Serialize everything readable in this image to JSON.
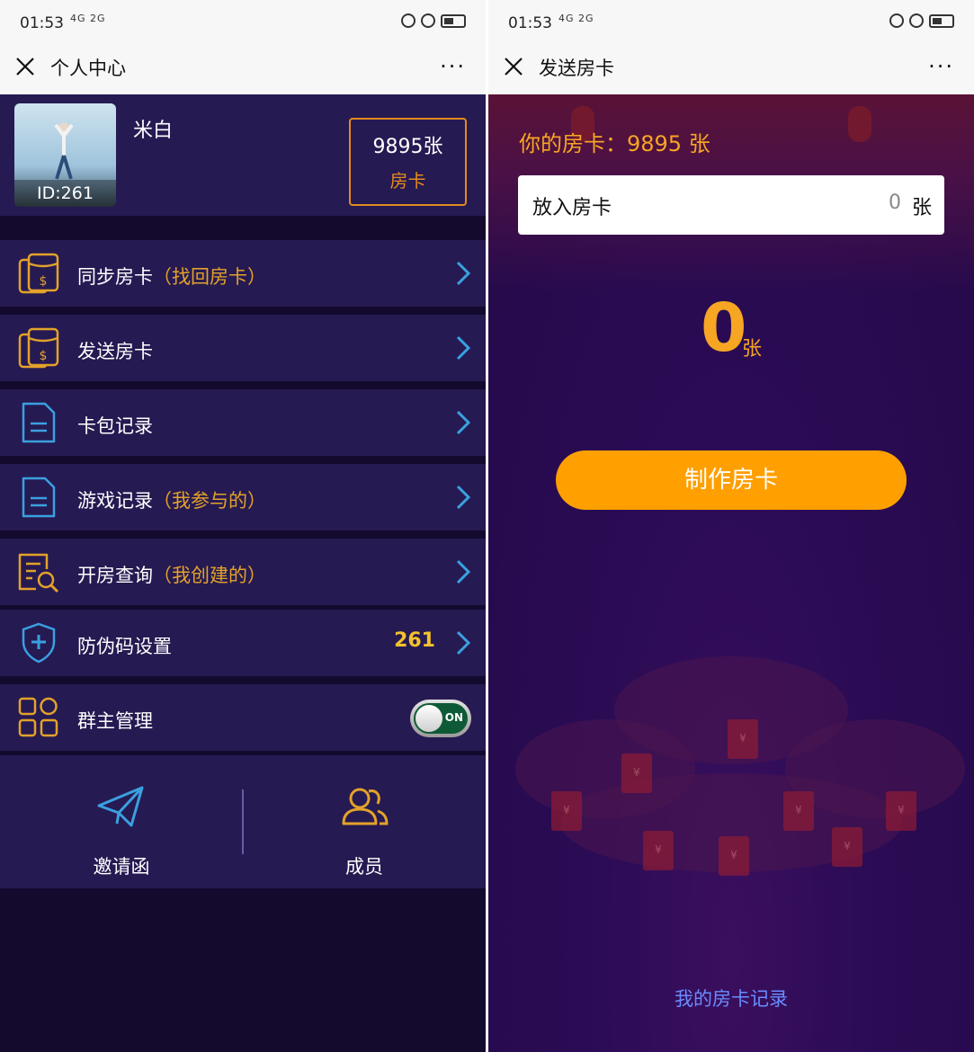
{
  "status_bar": {
    "time": "01:53",
    "signal": "4G 2G"
  },
  "left": {
    "title": "个人中心",
    "profile": {
      "name": "米白",
      "id": "ID:261",
      "card_count": "9895张",
      "card_label": "房卡"
    },
    "menu": [
      {
        "label": "同步房卡",
        "hint": "（找回房卡）",
        "icon": "coin-card-icon"
      },
      {
        "label": "发送房卡",
        "hint": "",
        "icon": "coin-card-icon"
      },
      {
        "label": "卡包记录",
        "hint": "",
        "icon": "document-icon"
      },
      {
        "label": "游戏记录",
        "hint": "（我参与的）",
        "icon": "document-icon"
      },
      {
        "label": "开房查询",
        "hint": "（我创建的）",
        "icon": "search-document-icon"
      },
      {
        "label": "防伪码设置",
        "hint": "",
        "value": "261",
        "icon": "shield-plus-icon"
      },
      {
        "label": "群主管理",
        "hint": "",
        "toggle": "ON",
        "icon": "grid-icon"
      }
    ],
    "bottom": {
      "invite_label": "邀请函",
      "members_label": "成员"
    }
  },
  "right": {
    "title": "发送房卡",
    "card_info": "你的房卡：9895 张",
    "input_label": "放入房卡",
    "input_value": "0",
    "input_unit": "张",
    "big_number": "0",
    "big_unit": "张",
    "make_button": "制作房卡",
    "records_link": "我的房卡记录"
  },
  "colors": {
    "accent_orange": "#f6a623",
    "button_orange": "#ff9f00",
    "menu_bg": "#261a52",
    "page_bg": "#140a2e",
    "icon_blue": "#3aa0e0",
    "icon_gold": "#e3a22a",
    "link_blue": "#6a8cff"
  }
}
